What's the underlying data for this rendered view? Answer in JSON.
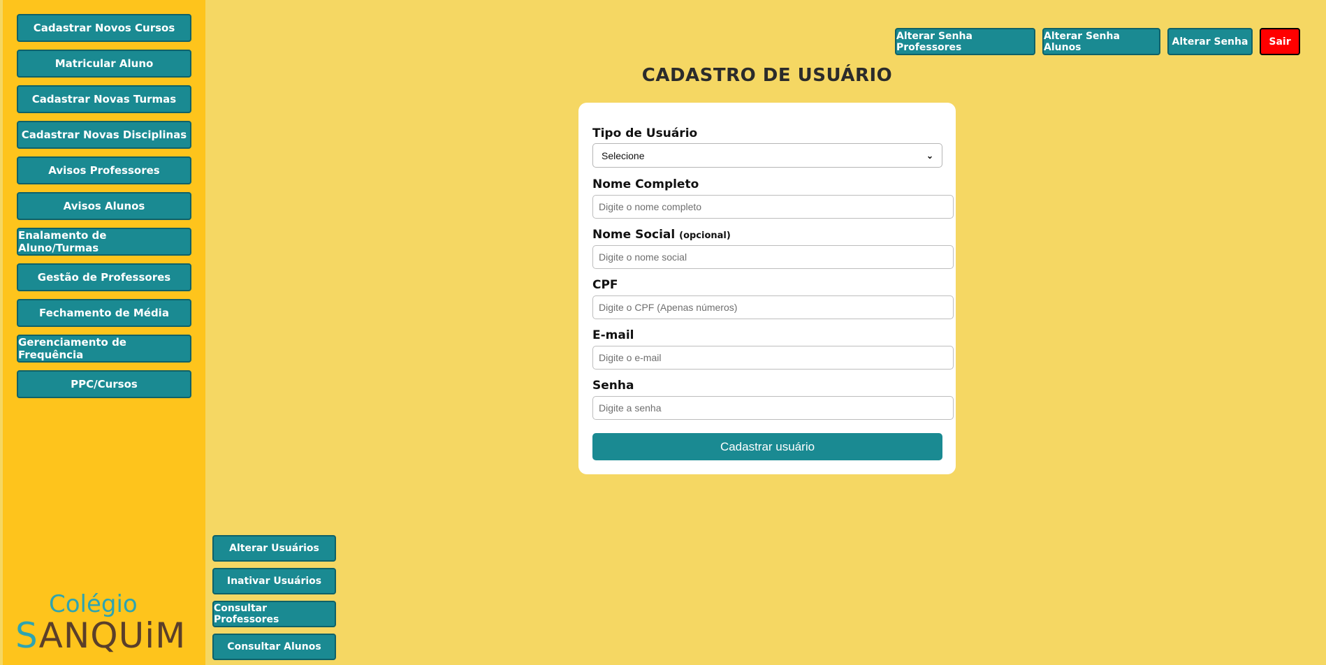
{
  "sidebar": {
    "items": [
      {
        "label": "Cadastrar Novos Cursos"
      },
      {
        "label": "Matricular Aluno"
      },
      {
        "label": "Cadastrar Novas Turmas"
      },
      {
        "label": "Cadastrar Novas Disciplinas"
      },
      {
        "label": "Avisos Professores"
      },
      {
        "label": "Avisos Alunos"
      },
      {
        "label": "Enalamento de Aluno/Turmas"
      },
      {
        "label": "Gestão de Professores"
      },
      {
        "label": "Fechamento de Média"
      },
      {
        "label": "Gerenciamento de Frequência"
      },
      {
        "label": "PPC/Cursos"
      }
    ],
    "logo": {
      "top": "Colégio",
      "main_first": "S",
      "main_rest": "ANQUiM"
    }
  },
  "bottom_menu": [
    {
      "label": "Alterar Usuários"
    },
    {
      "label": "Inativar Usuários"
    },
    {
      "label": "Consultar Professores"
    },
    {
      "label": "Consultar Alunos"
    }
  ],
  "top_bar": [
    {
      "label": "Alterar Senha Professores"
    },
    {
      "label": "Alterar Senha Alunos"
    },
    {
      "label": "Alterar Senha"
    },
    {
      "label": "Sair"
    }
  ],
  "form": {
    "title": "CADASTRO DE USUÁRIO",
    "tipo": {
      "label": "Tipo de Usuário",
      "selected": "Selecione"
    },
    "nome": {
      "label": "Nome Completo",
      "placeholder": "Digite o nome completo"
    },
    "nome_social": {
      "label": "Nome Social",
      "suffix": "(opcional)",
      "placeholder": "Digite o nome social"
    },
    "cpf": {
      "label": "CPF",
      "placeholder": "Digite o CPF (Apenas números)"
    },
    "email": {
      "label": "E-mail",
      "placeholder": "Digite o e-mail"
    },
    "senha": {
      "label": "Senha",
      "placeholder": "Digite a senha"
    },
    "submit_label": "Cadastrar usuário"
  },
  "colors": {
    "background": "#f5d763",
    "sidebar": "#fec41c",
    "button": "#1a8a92",
    "danger": "#ff0000"
  },
  "icons": {
    "dropdown": "chevron-down-icon"
  }
}
